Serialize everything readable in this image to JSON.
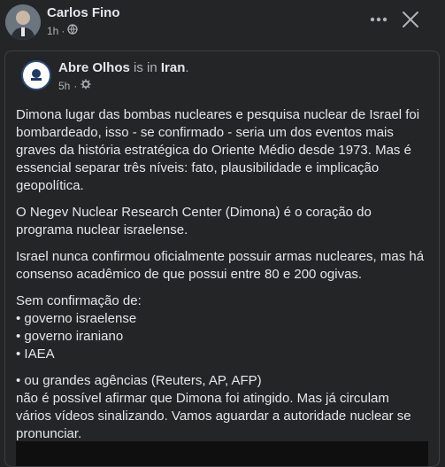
{
  "post": {
    "author": "Carlos Fino",
    "time": "1h",
    "privacy_icon": "globe-icon",
    "more_icon": "more-horizontal-icon",
    "close_icon": "close-icon"
  },
  "shared": {
    "page_name": "Abre Olhos",
    "is_in_text": "is in",
    "location": "Iran",
    "time": "5h",
    "settings_icon": "gear-icon",
    "paragraphs": [
      "Dimona lugar das bombas nucleares e pesquisa nuclear de Israel foi bombardeado, isso - se confirmado - seria um dos eventos mais graves da história estratégica do Oriente Médio desde 1973. Mas é essencial separar três níveis: fato, plausibilidade e implicação geopolítica.",
      "O Negev Nuclear Research Center (Dimona) é o coração do programa nuclear israelense.",
      "Israel nunca confirmou oficialmente possuir armas nucleares, mas há consenso acadêmico de que possui entre 80 e 200 ogivas."
    ],
    "list_intro": "Sem confirmação de:",
    "list_items": [
      "• governo israelense",
      "• governo iraniano",
      "• IAEA"
    ],
    "closing_lines": [
      "• ou grandes agências (Reuters, AP, AFP)",
      "não é possível afirmar que Dimona foi atingido. Mas já circulam vários vídeos sinalizando. Vamos aguardar a autoridade nuclear se pronunciar."
    ]
  },
  "colors": {
    "background": "#242526",
    "text_primary": "#e4e6eb",
    "text_secondary": "#b0b3b8",
    "border": "#3e4042"
  }
}
